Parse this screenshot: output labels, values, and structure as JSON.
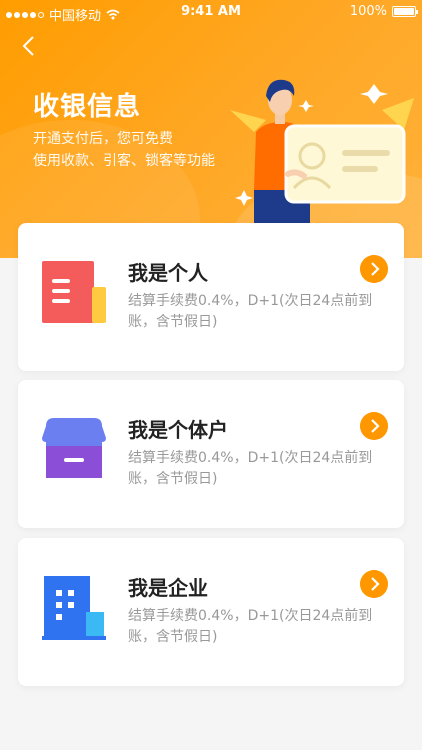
{
  "status_bar": {
    "carrier": "中国移动",
    "time": "9:41 AM",
    "battery": "100%"
  },
  "header": {
    "title": "收银信息",
    "desc_line1": "开通支付后，您可免费",
    "desc_line2": "使用收款、引客、锁客等功能"
  },
  "options": [
    {
      "title": "我是个人",
      "desc": "结算手续费0.4%，D+1(次日24点前到账，含节假日)",
      "icon": "document-icon"
    },
    {
      "title": "我是个体户",
      "desc": "结算手续费0.4%，D+1(次日24点前到账，含节假日)",
      "icon": "store-icon"
    },
    {
      "title": "我是企业",
      "desc": "结算手续费0.4%，D+1(次日24点前到账，含节假日)",
      "icon": "building-icon"
    }
  ],
  "colors": {
    "accent": "#ffa000",
    "title": "#222222",
    "desc": "#999999",
    "background": "#f5f5f5"
  }
}
